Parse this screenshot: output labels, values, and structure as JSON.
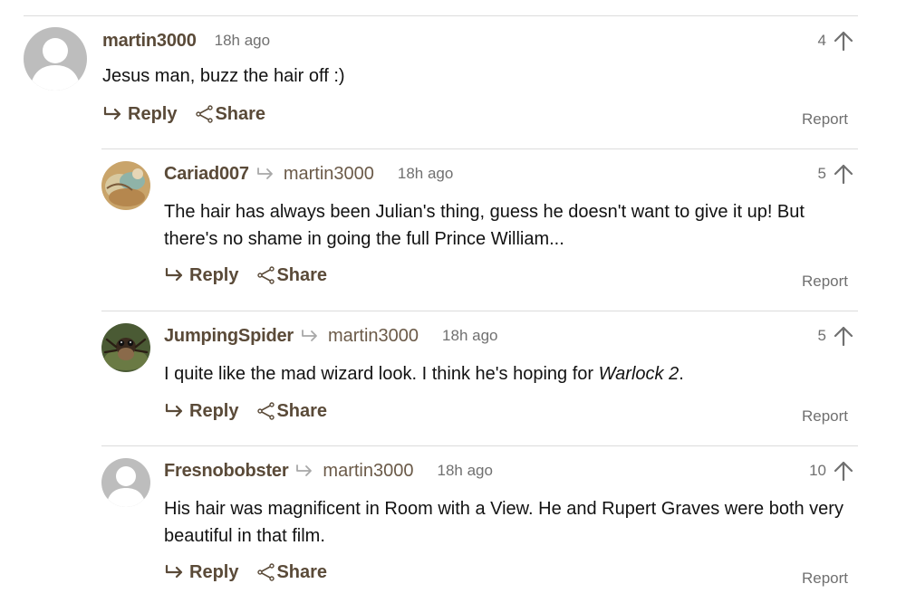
{
  "comments": [
    {
      "username": "martin3000",
      "reply_to": "",
      "timestamp": "18h ago",
      "votes": "4",
      "body": "Jesus man, buzz the hair off :)",
      "avatar": "default-avatar-icon"
    },
    {
      "username": "Cariad007",
      "reply_to": "martin3000",
      "timestamp": "18h ago",
      "votes": "5",
      "body": "The hair has always been Julian's thing, guess he doesn't want to give it up! But there's no shame in going the full Prince William...",
      "avatar": "photo-avatar"
    },
    {
      "username": "JumpingSpider",
      "reply_to": "martin3000",
      "timestamp": "18h ago",
      "votes": "5",
      "body_before": "I quite like the mad wizard look. I think he's hoping for ",
      "body_italic": "Warlock 2",
      "body_after": ".",
      "avatar": "spider-photo-avatar"
    },
    {
      "username": "Fresnobobster",
      "reply_to": "martin3000",
      "timestamp": "18h ago",
      "votes": "10",
      "body": "His hair was magnificent in Room with a View. He and Rupert Graves were both very beautiful in that film.",
      "avatar": "default-avatar-icon"
    }
  ],
  "actions": {
    "reply_label": "Reply",
    "share_label": "Share",
    "report_label": "Report"
  },
  "colors": {
    "username": "#5a4a38",
    "muted": "#707070",
    "divider": "#dcdcdc",
    "avatar_grey": "#bdbdbd"
  }
}
